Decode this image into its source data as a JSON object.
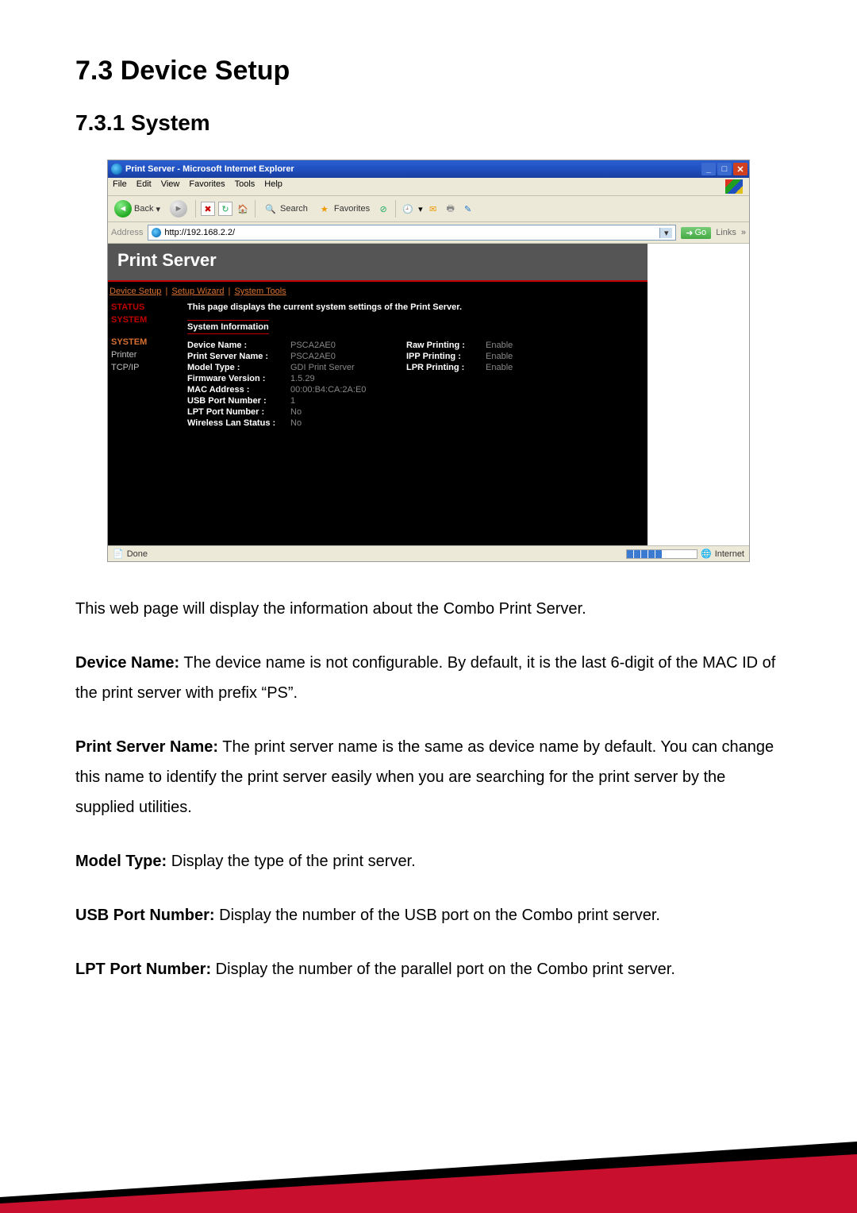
{
  "headings": {
    "section": "7.3    Device Setup",
    "subsection": "7.3.1    System"
  },
  "ie": {
    "title": "Print Server - Microsoft Internet Explorer",
    "menu": {
      "file": "File",
      "edit": "Edit",
      "view": "View",
      "favorites": "Favorites",
      "tools": "Tools",
      "help": "Help"
    },
    "toolbar": {
      "back": "Back",
      "search": "Search",
      "favorites": "Favorites"
    },
    "address_label": "Address",
    "url": "http://192.168.2.2/",
    "go": "Go",
    "links": "Links",
    "status_done": "Done",
    "status_zone": "Internet"
  },
  "printserver": {
    "header": "Print Server",
    "tabs": {
      "device_setup": "Device Setup",
      "setup_wizard": "Setup Wizard",
      "system_tools": "System Tools"
    },
    "sidebar": {
      "status": "STATUS",
      "system_group": "SYSTEM",
      "system": "SYSTEM",
      "printer": "Printer",
      "tcpip": "TCP/IP"
    },
    "desc": "This page displays the current system settings of the Print Server.",
    "sysinfo_head": "System Information",
    "rows_left": [
      {
        "label": "Device Name :",
        "value": "PSCA2AE0"
      },
      {
        "label": "Print Server Name :",
        "value": "PSCA2AE0"
      },
      {
        "label": "Model Type :",
        "value": "GDI Print Server"
      },
      {
        "label": "Firmware Version :",
        "value": "1.5.29"
      },
      {
        "label": "MAC Address :",
        "value": "00:00:B4:CA:2A:E0"
      },
      {
        "label": "USB Port Number :",
        "value": "1"
      },
      {
        "label": "LPT Port Number :",
        "value": "No"
      },
      {
        "label": "Wireless Lan Status :",
        "value": "No"
      }
    ],
    "rows_right": [
      {
        "label": "Raw Printing :",
        "value": "Enable"
      },
      {
        "label": "IPP Printing :",
        "value": "Enable"
      },
      {
        "label": "LPR Printing :",
        "value": "Enable"
      }
    ]
  },
  "body": {
    "p1": "This web page will display the information about the Combo Print Server.",
    "p2_label": "Device Name:",
    "p2_text": " The device name is not configurable. By default, it is the last 6-digit of the MAC ID of the print server with prefix “PS”.",
    "p3_label": "Print Server Name:",
    "p3_text": " The print server name is the same as device name by default. You can change this name to identify the print server easily when you are searching for the print server by the supplied utilities.",
    "p4_label": "Model Type:",
    "p4_text": " Display the type of the print server.",
    "p5_label": "USB Port Number:",
    "p5_text": " Display the number of the USB port on the Combo print server.",
    "p6_label": "LPT Port Number:",
    "p6_text": " Display the number of the parallel port on the Combo print server."
  }
}
